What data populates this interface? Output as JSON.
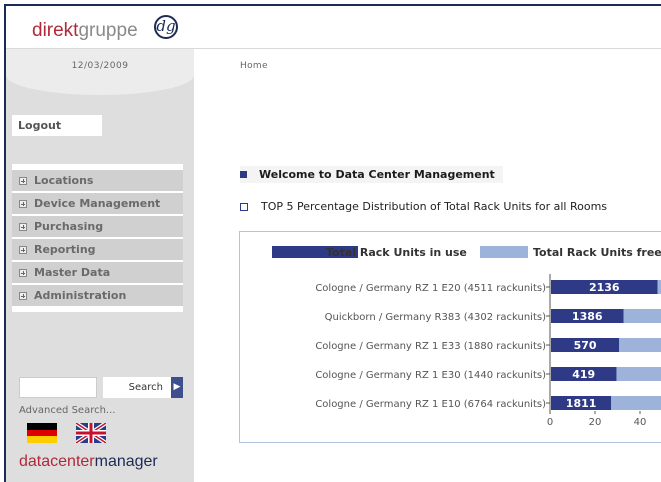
{
  "header": {
    "logo_brand_red": "direkt",
    "logo_brand_gray": "gruppe",
    "logo_mark": "dg"
  },
  "sidebar": {
    "date": "12/03/2009",
    "logout_label": "Logout",
    "menu": [
      {
        "label": "Locations",
        "icon": "plus-box-icon"
      },
      {
        "label": "Device Management",
        "icon": "plus-box-icon"
      },
      {
        "label": "Purchasing",
        "icon": "plus-box-icon"
      },
      {
        "label": "Reporting",
        "icon": "plus-box-icon"
      },
      {
        "label": "Master Data",
        "icon": "plus-box-icon"
      },
      {
        "label": "Administration",
        "icon": "plus-box-icon"
      }
    ],
    "search_value": "",
    "search_label": "Search",
    "advanced_search": "Advanced Search...",
    "languages": [
      "german-flag-icon",
      "uk-flag-icon"
    ],
    "footer_brand_red": "datacenter",
    "footer_brand_dark": "manager"
  },
  "main": {
    "breadcrumb": "Home",
    "welcome": "Welcome to Data Center Management",
    "top5_title": "TOP 5 Percentage Distribution of Total Rack Units for all Rooms"
  },
  "colors": {
    "brand_red": "#b0293a",
    "navy": "#1d2a56",
    "in_use": "#2e3a86",
    "free": "#9db3d9"
  },
  "chart_data": {
    "type": "bar",
    "orientation": "horizontal",
    "stacked": true,
    "categories": [
      "Cologne / Germany RZ 1 E20 (4511 rackunits)",
      "Quickborn / Germany R383 (4302 rackunits)",
      "Cologne / Germany RZ 1 E33 (1880 rackunits)",
      "Cologne / Germany RZ 1 E30 (1440 rackunits)",
      "Cologne / Germany RZ 1 E10 (6764 rackunits)"
    ],
    "series": [
      {
        "name": "Total Rack Units in use",
        "values": [
          47.35,
          32.22,
          30.32,
          29.1,
          26.77
        ],
        "labels": [
          "2136",
          "1386",
          "570",
          "419",
          "1811"
        ]
      },
      {
        "name": "Total Rack Units free",
        "values": [
          52.65,
          67.78,
          69.68,
          70.9,
          73.23
        ]
      }
    ],
    "xlim": [
      0,
      100
    ],
    "xticks": [
      0,
      20,
      40
    ],
    "legend": "top"
  }
}
